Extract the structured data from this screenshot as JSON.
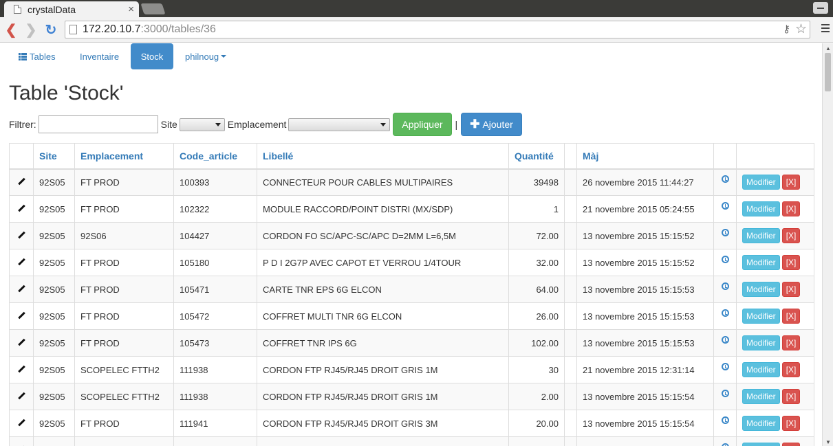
{
  "browser": {
    "tab_title": "crystalData",
    "tab_close": "×",
    "url_host": "172.20.10.7",
    "url_path": ":3000/tables/36"
  },
  "nav": {
    "tables": "Tables",
    "inventaire": "Inventaire",
    "stock": "Stock",
    "user": "philnoug"
  },
  "page": {
    "title": "Table 'Stock'"
  },
  "filters": {
    "filter_label": "Filtrer:",
    "filter_value": "",
    "site_label": "Site",
    "site_value": "",
    "emplacement_label": "Emplacement",
    "emplacement_value": "",
    "apply_label": "Appliquer",
    "separator": "|",
    "add_label": "Ajouter"
  },
  "table": {
    "headers": {
      "site": "Site",
      "emplacement": "Emplacement",
      "code_article": "Code_article",
      "libelle": "Libellé",
      "quantite": "Quantité",
      "maj": "Màj"
    },
    "modify_label": "Modifier",
    "delete_label": "[X]",
    "rows": [
      {
        "site": "92S05",
        "emplacement": "FT PROD",
        "code": "100393",
        "libelle": "CONNECTEUR POUR CABLES MULTIPAIRES",
        "qty": "39498",
        "maj": "26 novembre 2015 11:44:27"
      },
      {
        "site": "92S05",
        "emplacement": "FT PROD",
        "code": "102322",
        "libelle": "MODULE RACCORD/POINT DISTRI (MX/SDP)",
        "qty": "1",
        "maj": "21 novembre 2015 05:24:55"
      },
      {
        "site": "92S05",
        "emplacement": "92S06",
        "code": "104427",
        "libelle": "CORDON FO SC/APC-SC/APC D=2MM L=6,5M",
        "qty": "72.00",
        "maj": "13 novembre 2015 15:15:52"
      },
      {
        "site": "92S05",
        "emplacement": "FT PROD",
        "code": "105180",
        "libelle": "P D I 2G7P AVEC CAPOT ET VERROU 1/4TOUR",
        "qty": "32.00",
        "maj": "13 novembre 2015 15:15:52"
      },
      {
        "site": "92S05",
        "emplacement": "FT PROD",
        "code": "105471",
        "libelle": "CARTE TNR EPS 6G ELCON",
        "qty": "64.00",
        "maj": "13 novembre 2015 15:15:53"
      },
      {
        "site": "92S05",
        "emplacement": "FT PROD",
        "code": "105472",
        "libelle": "COFFRET MULTI TNR 6G ELCON",
        "qty": "26.00",
        "maj": "13 novembre 2015 15:15:53"
      },
      {
        "site": "92S05",
        "emplacement": "FT PROD",
        "code": "105473",
        "libelle": "COFFRET TNR IPS 6G",
        "qty": "102.00",
        "maj": "13 novembre 2015 15:15:53"
      },
      {
        "site": "92S05",
        "emplacement": "SCOPELEC FTTH2",
        "code": "111938",
        "libelle": "CORDON FTP RJ45/RJ45 DROIT GRIS 1M",
        "qty": "30",
        "maj": "21 novembre 2015 12:31:14"
      },
      {
        "site": "92S05",
        "emplacement": "SCOPELEC FTTH2",
        "code": "111938",
        "libelle": "CORDON FTP RJ45/RJ45 DROIT GRIS 1M",
        "qty": "2.00",
        "maj": "13 novembre 2015 15:15:54"
      },
      {
        "site": "92S05",
        "emplacement": "FT PROD",
        "code": "111941",
        "libelle": "CORDON FTP RJ45/RJ45 DROIT GRIS 3M",
        "qty": "20.00",
        "maj": "13 novembre 2015 15:15:54"
      },
      {
        "site": "",
        "emplacement": "",
        "code": "",
        "libelle": "",
        "qty": "",
        "maj": ""
      }
    ]
  },
  "icons": {
    "edit": "pencil-icon",
    "history": "clock-icon",
    "add": "plus-icon",
    "tables": "list-icon"
  },
  "colors": {
    "primary": "#428bca",
    "success": "#5cb85c",
    "info": "#5bc0de",
    "danger": "#d9534f"
  }
}
